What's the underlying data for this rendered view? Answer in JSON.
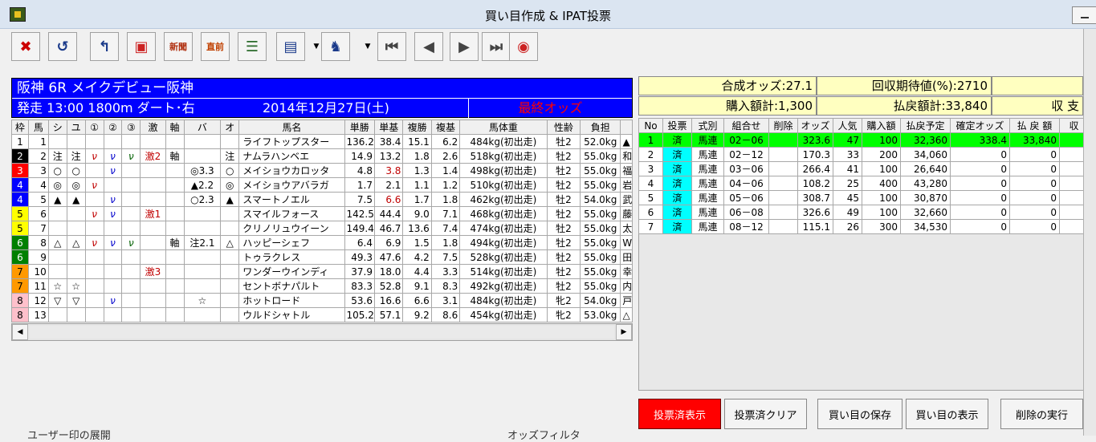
{
  "window": {
    "title": "買い目作成 & IPAT投票"
  },
  "toolbar": {
    "buttons": [
      {
        "icon": "close-icon",
        "glyph": "✖",
        "color": "#cc0000"
      },
      {
        "icon": "undo-icon",
        "glyph": "↺",
        "color": "#1a3a8a"
      },
      {
        "icon": "return-icon",
        "glyph": "↰",
        "color": "#1a3a8a"
      },
      {
        "icon": "card-icon",
        "glyph": "▣",
        "color": "#cc2222"
      },
      {
        "icon": "newspaper-icon",
        "label": "新聞",
        "color": "#b03010"
      },
      {
        "icon": "just-before-icon",
        "label": "直前",
        "color": "#c04000"
      },
      {
        "icon": "list-numbers-icon",
        "glyph": "☰",
        "color": "#2a6a2a"
      },
      {
        "icon": "checklist-icon",
        "glyph": "▤",
        "color": "#1a3a8a"
      },
      {
        "icon": "horse-check-icon",
        "glyph": "♞",
        "color": "#1a3a8a"
      },
      {
        "icon": "first-icon",
        "glyph": "⏮",
        "color": "#444"
      },
      {
        "icon": "prev-icon",
        "glyph": "◀",
        "color": "#444"
      },
      {
        "icon": "next-icon",
        "glyph": "▶",
        "color": "#444"
      },
      {
        "icon": "last-icon",
        "glyph": "⏭",
        "color": "#444"
      },
      {
        "icon": "speed-icon",
        "glyph": "◉",
        "color": "#cc2222"
      }
    ]
  },
  "race": {
    "title": "阪神 6R メイクデビュー阪神",
    "start": "発走 13:00 1800m ダート･右",
    "date": "2014年12月27日(土)",
    "odds_status": "最終オッズ"
  },
  "horse_headers": [
    "枠",
    "馬",
    "シ",
    "ユ",
    "①",
    "②",
    "③",
    "激",
    "軸",
    "バ",
    "オ",
    "馬名",
    "単勝",
    "単基",
    "複勝",
    "複基",
    "馬体重",
    "性齢",
    "負担",
    ""
  ],
  "horses": [
    {
      "waku": "1",
      "uma": "1",
      "shi": "",
      "yu": "",
      "m1": "",
      "m2": "",
      "m3": "",
      "geki": "",
      "jiku": "",
      "ba": "",
      "o": "",
      "name": "ライフトップスター",
      "tan": "136.2",
      "tanki": "38.4",
      "fuku": "15.1",
      "fukuki": "6.2",
      "weight": "484kg(初出走)",
      "sex": "牡2",
      "futan": "52.0kg",
      "jockey": "▲"
    },
    {
      "waku": "2",
      "uma": "2",
      "shi": "注",
      "yu": "注",
      "m1": "ν",
      "m2": "ν",
      "m3": "ν",
      "geki": "激2",
      "jiku": "軸",
      "ba": "",
      "o": "注",
      "name": "ナムラハンベエ",
      "tan": "14.9",
      "tanki": "13.2",
      "fuku": "1.8",
      "fukuki": "2.6",
      "weight": "518kg(初出走)",
      "sex": "牡2",
      "futan": "55.0kg",
      "jockey": "和"
    },
    {
      "waku": "3",
      "uma": "3",
      "shi": "○",
      "yu": "○",
      "m1": "",
      "m2": "ν",
      "m3": "",
      "geki": "",
      "jiku": "",
      "ba": "◎3.3",
      "o": "○",
      "name": "メイショウカロッタ",
      "tan": "4.8",
      "tanki": "3.8",
      "fuku": "1.3",
      "fukuki": "1.4",
      "weight": "498kg(初出走)",
      "sex": "牡2",
      "futan": "55.0kg",
      "jockey": "福"
    },
    {
      "waku": "4",
      "uma": "4",
      "shi": "◎",
      "yu": "◎",
      "m1": "ν",
      "m2": "",
      "m3": "",
      "geki": "",
      "jiku": "",
      "ba": "▲2.2",
      "o": "◎",
      "name": "メイショウアバラガ",
      "tan": "1.7",
      "tanki": "2.1",
      "fuku": "1.1",
      "fukuki": "1.2",
      "weight": "510kg(初出走)",
      "sex": "牡2",
      "futan": "55.0kg",
      "jockey": "岩"
    },
    {
      "waku": "4",
      "uma": "5",
      "shi": "▲",
      "yu": "▲",
      "m1": "",
      "m2": "ν",
      "m3": "",
      "geki": "",
      "jiku": "",
      "ba": "○2.3",
      "o": "▲",
      "name": "スマートノエル",
      "tan": "7.5",
      "tanki": "6.6",
      "fuku": "1.7",
      "fukuki": "1.8",
      "weight": "462kg(初出走)",
      "sex": "牡2",
      "futan": "54.0kg",
      "jockey": "武"
    },
    {
      "waku": "5",
      "uma": "6",
      "shi": "",
      "yu": "",
      "m1": "ν",
      "m2": "ν",
      "m3": "",
      "geki": "激1",
      "jiku": "",
      "ba": "",
      "o": "",
      "name": "スマイルフォース",
      "tan": "142.5",
      "tanki": "44.4",
      "fuku": "9.0",
      "fukuki": "7.1",
      "weight": "468kg(初出走)",
      "sex": "牡2",
      "futan": "55.0kg",
      "jockey": "藤"
    },
    {
      "waku": "5",
      "uma": "7",
      "shi": "",
      "yu": "",
      "m1": "",
      "m2": "",
      "m3": "",
      "geki": "",
      "jiku": "",
      "ba": "",
      "o": "",
      "name": "クリノリュウイーン",
      "tan": "149.4",
      "tanki": "46.7",
      "fuku": "13.6",
      "fukuki": "7.4",
      "weight": "474kg(初出走)",
      "sex": "牡2",
      "futan": "55.0kg",
      "jockey": "太"
    },
    {
      "waku": "6",
      "uma": "8",
      "shi": "△",
      "yu": "△",
      "m1": "ν",
      "m2": "ν",
      "m3": "ν",
      "geki": "",
      "jiku": "軸",
      "ba": "注2.1",
      "o": "△",
      "name": "ハッピーシェフ",
      "tan": "6.4",
      "tanki": "6.9",
      "fuku": "1.5",
      "fukuki": "1.8",
      "weight": "494kg(初出走)",
      "sex": "牡2",
      "futan": "55.0kg",
      "jockey": "W"
    },
    {
      "waku": "6",
      "uma": "9",
      "shi": "",
      "yu": "",
      "m1": "",
      "m2": "",
      "m3": "",
      "geki": "",
      "jiku": "",
      "ba": "",
      "o": "",
      "name": "トゥラクレス",
      "tan": "49.3",
      "tanki": "47.6",
      "fuku": "4.2",
      "fukuki": "7.5",
      "weight": "528kg(初出走)",
      "sex": "牡2",
      "futan": "55.0kg",
      "jockey": "田"
    },
    {
      "waku": "7",
      "uma": "10",
      "shi": "",
      "yu": "",
      "m1": "",
      "m2": "",
      "m3": "",
      "geki": "激3",
      "jiku": "",
      "ba": "",
      "o": "",
      "name": "ワンダーウインディ",
      "tan": "37.9",
      "tanki": "18.0",
      "fuku": "4.4",
      "fukuki": "3.3",
      "weight": "514kg(初出走)",
      "sex": "牡2",
      "futan": "55.0kg",
      "jockey": "幸"
    },
    {
      "waku": "7",
      "uma": "11",
      "shi": "☆",
      "yu": "☆",
      "m1": "",
      "m2": "",
      "m3": "",
      "geki": "",
      "jiku": "",
      "ba": "",
      "o": "",
      "name": "セントボナパルト",
      "tan": "83.3",
      "tanki": "52.8",
      "fuku": "9.1",
      "fukuki": "8.3",
      "weight": "492kg(初出走)",
      "sex": "牡2",
      "futan": "55.0kg",
      "jockey": "内"
    },
    {
      "waku": "8",
      "uma": "12",
      "shi": "▽",
      "yu": "▽",
      "m1": "",
      "m2": "ν",
      "m3": "",
      "geki": "",
      "jiku": "",
      "ba": "☆",
      "o": "",
      "name": "ホットロード",
      "tan": "53.6",
      "tanki": "16.6",
      "fuku": "6.6",
      "fukuki": "3.1",
      "weight": "484kg(初出走)",
      "sex": "牝2",
      "futan": "54.0kg",
      "jockey": "戸"
    },
    {
      "waku": "8",
      "uma": "13",
      "shi": "",
      "yu": "",
      "m1": "",
      "m2": "",
      "m3": "",
      "geki": "",
      "jiku": "",
      "ba": "",
      "o": "",
      "name": "ウルドシャトル",
      "tan": "105.2",
      "tanki": "57.1",
      "fuku": "9.2",
      "fukuki": "8.6",
      "weight": "454kg(初出走)",
      "sex": "牝2",
      "futan": "53.0kg",
      "jockey": "△"
    }
  ],
  "summary": {
    "odds": "合成オッズ:27.1",
    "expected": "回収期待値(%):2710",
    "purchase": "購入額計:1,300",
    "payout": "払戻額計:33,840",
    "balance": "収 支"
  },
  "purchase_headers": [
    "No",
    "投票",
    "式別",
    "組合せ",
    "削除",
    "オッズ",
    "人気",
    "購入額",
    "払戻予定",
    "確定オッズ",
    "払 戻 額",
    "収"
  ],
  "purchases": [
    {
      "no": "1",
      "vote": "済",
      "type": "馬連",
      "combo": "02－06",
      "del": "",
      "odds": "323.6",
      "pop": "47",
      "amt": "100",
      "pay": "32,360",
      "fodds": "338.4",
      "payout": "33,840",
      "sel": true
    },
    {
      "no": "2",
      "vote": "済",
      "type": "馬連",
      "combo": "02－12",
      "del": "",
      "odds": "170.3",
      "pop": "33",
      "amt": "200",
      "pay": "34,060",
      "fodds": "0",
      "payout": "0",
      "sel": false
    },
    {
      "no": "3",
      "vote": "済",
      "type": "馬連",
      "combo": "03－06",
      "del": "",
      "odds": "266.4",
      "pop": "41",
      "amt": "100",
      "pay": "26,640",
      "fodds": "0",
      "payout": "0",
      "sel": false
    },
    {
      "no": "4",
      "vote": "済",
      "type": "馬連",
      "combo": "04－06",
      "del": "",
      "odds": "108.2",
      "pop": "25",
      "amt": "400",
      "pay": "43,280",
      "fodds": "0",
      "payout": "0",
      "sel": false
    },
    {
      "no": "5",
      "vote": "済",
      "type": "馬連",
      "combo": "05－06",
      "del": "",
      "odds": "308.7",
      "pop": "45",
      "amt": "100",
      "pay": "30,870",
      "fodds": "0",
      "payout": "0",
      "sel": false
    },
    {
      "no": "6",
      "vote": "済",
      "type": "馬連",
      "combo": "06－08",
      "del": "",
      "odds": "326.6",
      "pop": "49",
      "amt": "100",
      "pay": "32,660",
      "fodds": "0",
      "payout": "0",
      "sel": false
    },
    {
      "no": "7",
      "vote": "済",
      "type": "馬連",
      "combo": "08－12",
      "del": "",
      "odds": "115.1",
      "pop": "26",
      "amt": "300",
      "pay": "34,530",
      "fodds": "0",
      "payout": "0",
      "sel": false
    }
  ],
  "buttons": {
    "show_voted": "投票済表示",
    "clear_voted": "投票済クリア",
    "save": "買い目の保存",
    "show": "買い目の表示",
    "delete": "削除の実行"
  },
  "bottom": {
    "left_label": "ユーザー印の展開",
    "right_label": "オッズフィルタ"
  }
}
